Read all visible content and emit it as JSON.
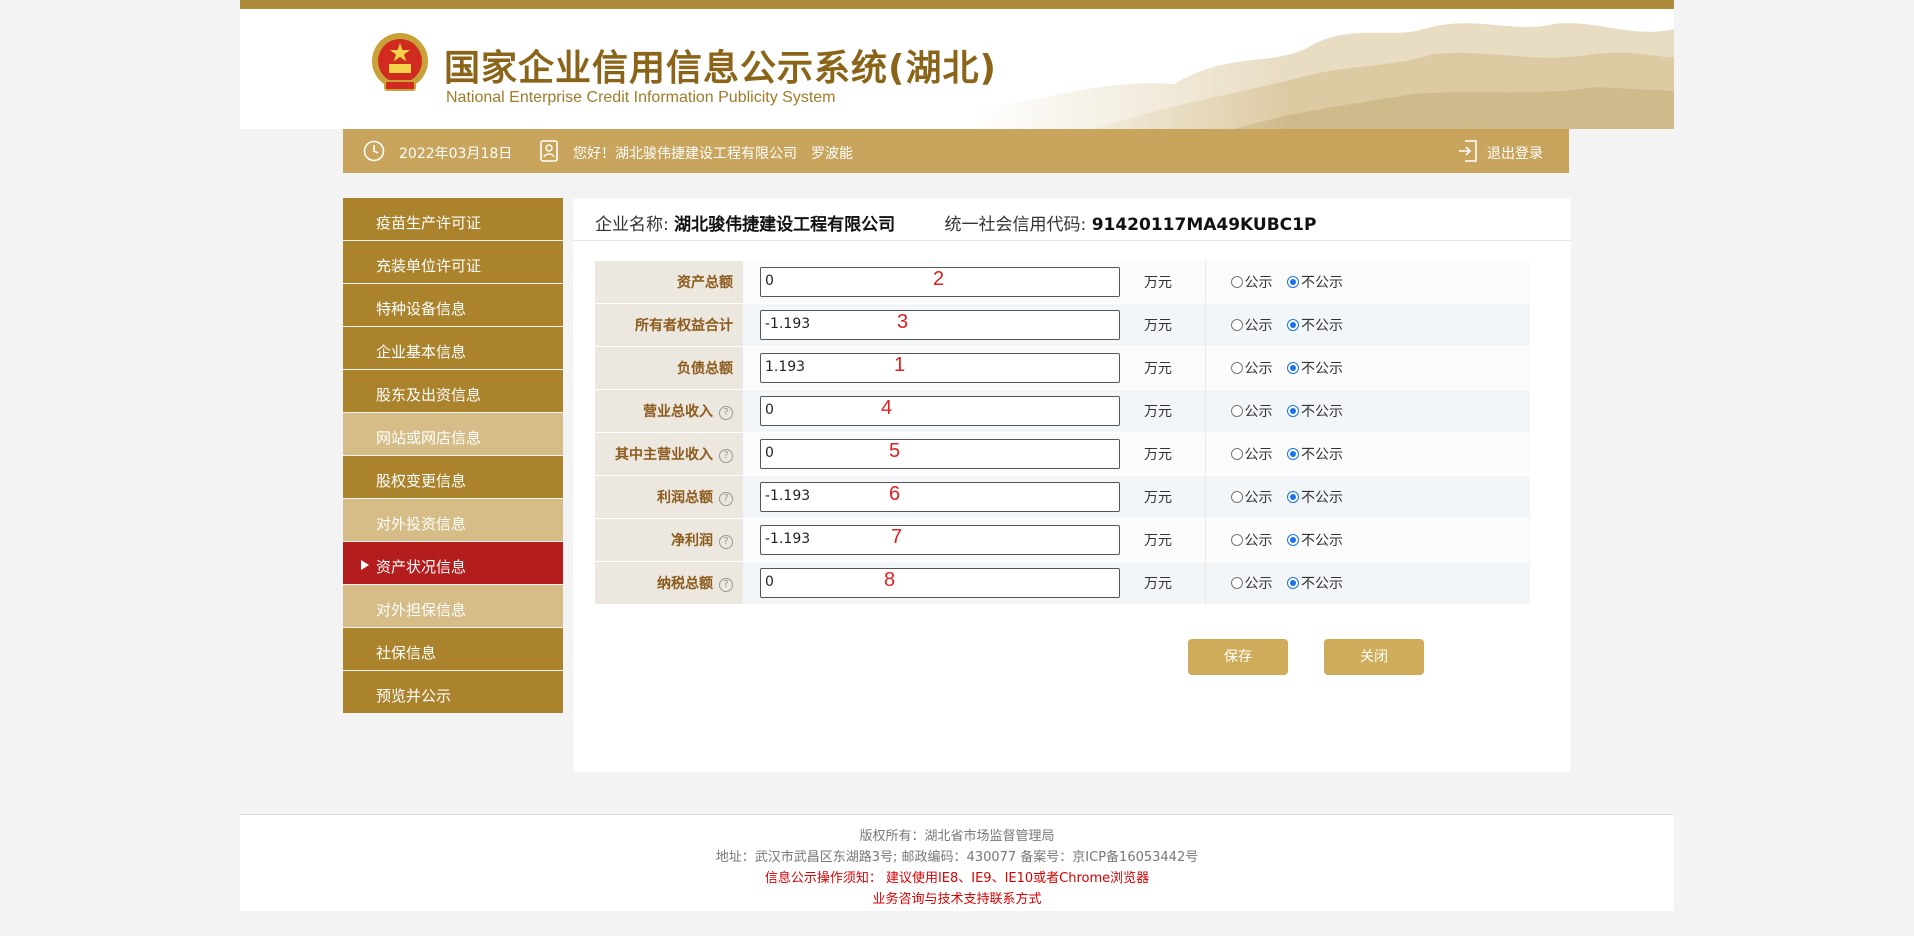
{
  "header": {
    "title": "国家企业信用信息公示系统(湖北)",
    "subtitle": "National Enterprise Credit Information Publicity System"
  },
  "infobar": {
    "date": "2022年03月18日",
    "greeting": "您好！湖北骏伟捷建设工程有限公司",
    "user": "罗波能",
    "logout": "退出登录"
  },
  "sidebar": {
    "items": [
      {
        "label": "疫苗生产许可证",
        "state": "dark"
      },
      {
        "label": "充装单位许可证",
        "state": "dark"
      },
      {
        "label": "特种设备信息",
        "state": "dark"
      },
      {
        "label": "企业基本信息",
        "state": "dark"
      },
      {
        "label": "股东及出资信息",
        "state": "dark"
      },
      {
        "label": "网站或网店信息",
        "state": "light"
      },
      {
        "label": "股权变更信息",
        "state": "dark"
      },
      {
        "label": "对外投资信息",
        "state": "light"
      },
      {
        "label": "资产状况信息",
        "state": "active"
      },
      {
        "label": "对外担保信息",
        "state": "light"
      },
      {
        "label": "社保信息",
        "state": "dark"
      },
      {
        "label": "预览并公示",
        "state": "dark"
      }
    ]
  },
  "company": {
    "name_label": "企业名称:",
    "name": "湖北骏伟捷建设工程有限公司",
    "code_label": "统一社会信用代码:",
    "code": "91420117MA49KUBC1P"
  },
  "form": {
    "unit": "万元",
    "opt_public": "公示",
    "opt_private": "不公示",
    "rows": [
      {
        "label": "资产总额",
        "value": "0",
        "help": false,
        "annotation": "2"
      },
      {
        "label": "所有者权益合计",
        "value": "-1.193",
        "help": false,
        "annotation": "3"
      },
      {
        "label": "负债总额",
        "value": "1.193",
        "help": false,
        "annotation": "1"
      },
      {
        "label": "营业总收入",
        "value": "0",
        "help": true,
        "annotation": "4"
      },
      {
        "label": "其中主营业收入",
        "value": "0",
        "help": true,
        "annotation": "5"
      },
      {
        "label": "利润总额",
        "value": "-1.193",
        "help": true,
        "annotation": "6"
      },
      {
        "label": "净利润",
        "value": "-1.193",
        "help": true,
        "annotation": "7"
      },
      {
        "label": "纳税总额",
        "value": "0",
        "help": true,
        "annotation": "8"
      }
    ],
    "selected_option": "不公示",
    "help_symbol": "?"
  },
  "buttons": {
    "save": "保存",
    "close": "关闭"
  },
  "footer": {
    "copyright": "版权所有：湖北省市场监督管理局",
    "address": "地址：武汉市武昌区东湖路3号; 邮政编码：430077 备案号：京ICP备16053442号",
    "notice": "信息公示操作须知：  建议使用IE8、IE9、IE10或者Chrome浏览器",
    "support": "业务咨询与技术支持联系方式"
  },
  "colors": {
    "brand_gold": "#ac832d",
    "light_gold": "#d6bc86",
    "active_red": "#b31d1d",
    "button_gold": "#cfac5a",
    "radio_blue": "#1a73e8"
  }
}
